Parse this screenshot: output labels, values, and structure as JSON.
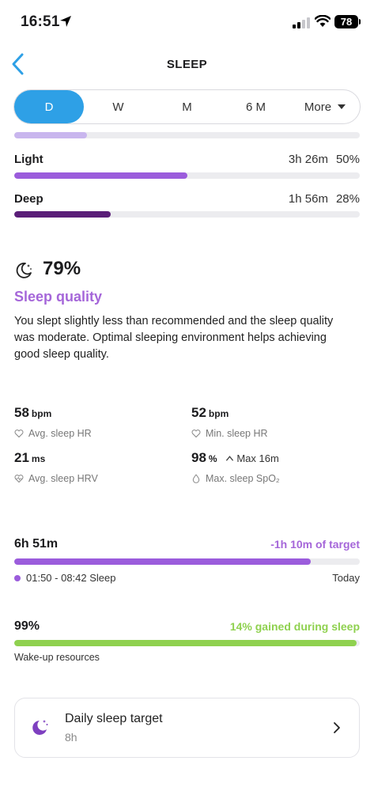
{
  "status_bar": {
    "time": "16:51",
    "battery": "78"
  },
  "header": {
    "title": "SLEEP"
  },
  "tabs": [
    {
      "label": "D",
      "active": true
    },
    {
      "label": "W"
    },
    {
      "label": "M"
    },
    {
      "label": "6 M"
    },
    {
      "label": "More"
    }
  ],
  "stages": {
    "rem": {
      "fill_fraction": 0.21,
      "color": "#c9b6ee"
    },
    "light": {
      "label": "Light",
      "duration": "3h 26m",
      "percent": "50%",
      "fill_fraction": 0.5,
      "color": "#9b5cdc"
    },
    "deep": {
      "label": "Deep",
      "duration": "1h 56m",
      "percent": "28%",
      "fill_fraction": 0.28,
      "color": "#5a1e78"
    }
  },
  "quality": {
    "percent": "79%",
    "title": "Sleep quality",
    "description": "You slept slightly less than recommended and the sleep quality was moderate. Optimal sleeping environment helps achieving good sleep quality."
  },
  "metrics": {
    "avg_hr": {
      "value": "58",
      "unit": "bpm",
      "label": "Avg. sleep HR"
    },
    "min_hr": {
      "value": "52",
      "unit": "bpm",
      "label": "Min. sleep HR"
    },
    "hrv": {
      "value": "21",
      "unit": "ms",
      "label": "Avg. sleep HRV"
    },
    "spo2": {
      "value": "98",
      "unit": "%",
      "max": "Max 16m",
      "label": "Max. sleep SpO₂"
    }
  },
  "sleep_duration": {
    "total": "6h 51m",
    "vs_target": "-1h 10m of target",
    "window": "01:50 - 08:42 Sleep",
    "day": "Today",
    "fill_fraction": 0.857,
    "color": "#9b5cdc"
  },
  "resources": {
    "percent": "99%",
    "gained": "14% gained during sleep",
    "label": "Wake-up resources",
    "fill_fraction": 0.99,
    "color": "#8fd14f"
  },
  "target_card": {
    "title": "Daily sleep target",
    "value": "8h"
  },
  "colors": {
    "accent_blue": "#2ea0e6",
    "purple": "#a566d9",
    "green": "#8fd14f"
  }
}
